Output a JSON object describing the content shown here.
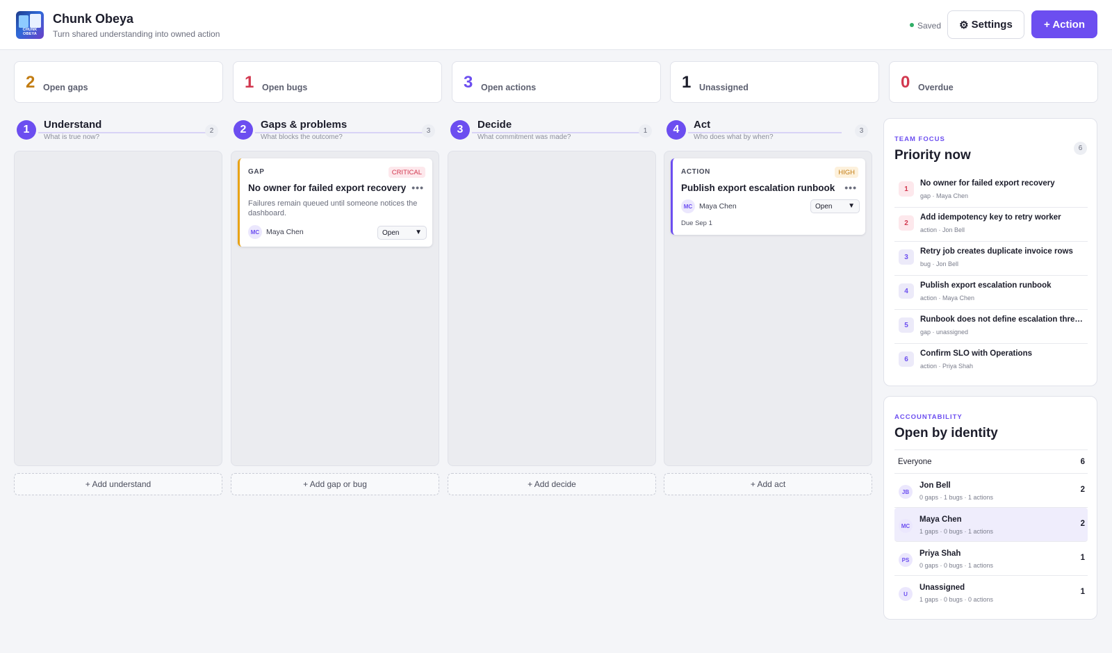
{
  "app": {
    "title": "Chunk Obeya",
    "subtitle": "Turn shared understanding into owned action",
    "logo_text": "CHUNK OBEYA"
  },
  "header": {
    "saved_label": "Saved",
    "settings_icon": "⚙",
    "settings_label": "Settings",
    "action_label": "+ Action"
  },
  "stats": [
    {
      "value": "2",
      "label": "Open gaps",
      "color": "#c27c12"
    },
    {
      "value": "1",
      "label": "Open bugs",
      "color": "#d2384f"
    },
    {
      "value": "3",
      "label": "Open actions",
      "color": "#6c4ef0"
    },
    {
      "value": "1",
      "label": "Unassigned",
      "color": "#1c1d2b"
    },
    {
      "value": "0",
      "label": "Overdue",
      "color": "#d2384f"
    }
  ],
  "lanes": [
    {
      "step": "1",
      "name": "Understand",
      "hint": "What is true now?",
      "count": "2",
      "add_label": "+ Add understand"
    },
    {
      "step": "2",
      "name": "Gaps & problems",
      "hint": "What blocks the outcome?",
      "count": "3",
      "add_label": "+ Add gap or bug"
    },
    {
      "step": "3",
      "name": "Decide",
      "hint": "What commitment was made?",
      "count": "1",
      "add_label": "+ Add decide"
    },
    {
      "step": "4",
      "name": "Act",
      "hint": "Who does what by when?",
      "count": "3",
      "add_label": "+ Add act"
    }
  ],
  "cards": {
    "gap": {
      "type": "GAP",
      "severity": "CRITICAL",
      "title": "No owner for failed export recovery",
      "description": "Failures remain queued until someone notices the dashboard.",
      "owner_initials": "MC",
      "owner": "Maya Chen",
      "status": "Open",
      "accent": "#e8a317"
    },
    "action": {
      "type": "ACTION",
      "severity": "HIGH",
      "title": "Publish export escalation runbook",
      "owner_initials": "MC",
      "owner": "Maya Chen",
      "status": "Open",
      "due": "Due Sep 1",
      "accent": "#6c4ef0"
    }
  },
  "priority": {
    "kicker": "TEAM FOCUS",
    "title": "Priority now",
    "count": "6",
    "items": [
      {
        "rank": "1",
        "title": "No owner for failed export recovery",
        "meta": "gap · Maya Chen"
      },
      {
        "rank": "2",
        "title": "Add idempotency key to retry worker",
        "meta": "action · Jon Bell"
      },
      {
        "rank": "3",
        "title": "Retry job creates duplicate invoice rows",
        "meta": "bug · Jon Bell"
      },
      {
        "rank": "4",
        "title": "Publish export escalation runbook",
        "meta": "action · Maya Chen"
      },
      {
        "rank": "5",
        "title": "Runbook does not define escalation thresh...",
        "meta": "gap · unassigned"
      },
      {
        "rank": "6",
        "title": "Confirm SLO with Operations",
        "meta": "action · Priya Shah"
      }
    ]
  },
  "accountability": {
    "kicker": "ACCOUNTABILITY",
    "title": "Open by identity",
    "everyone_label": "Everyone",
    "everyone_count": "6",
    "people": [
      {
        "initials": "JB",
        "name": "Jon Bell",
        "meta": "0 gaps · 1 bugs · 1 actions",
        "count": "2"
      },
      {
        "initials": "MC",
        "name": "Maya Chen",
        "meta": "1 gaps · 0 bugs · 1 actions",
        "count": "2"
      },
      {
        "initials": "PS",
        "name": "Priya Shah",
        "meta": "0 gaps · 0 bugs · 1 actions",
        "count": "1"
      },
      {
        "initials": "U",
        "name": "Unassigned",
        "meta": "1 gaps · 0 bugs · 0 actions",
        "count": "1"
      }
    ]
  },
  "colors": {
    "accent": "#6c4ef0",
    "critical_bg": "#fde8ec",
    "critical_fg": "#d2384f",
    "high_bg": "#fdf1dc",
    "high_fg": "#c27c12"
  }
}
